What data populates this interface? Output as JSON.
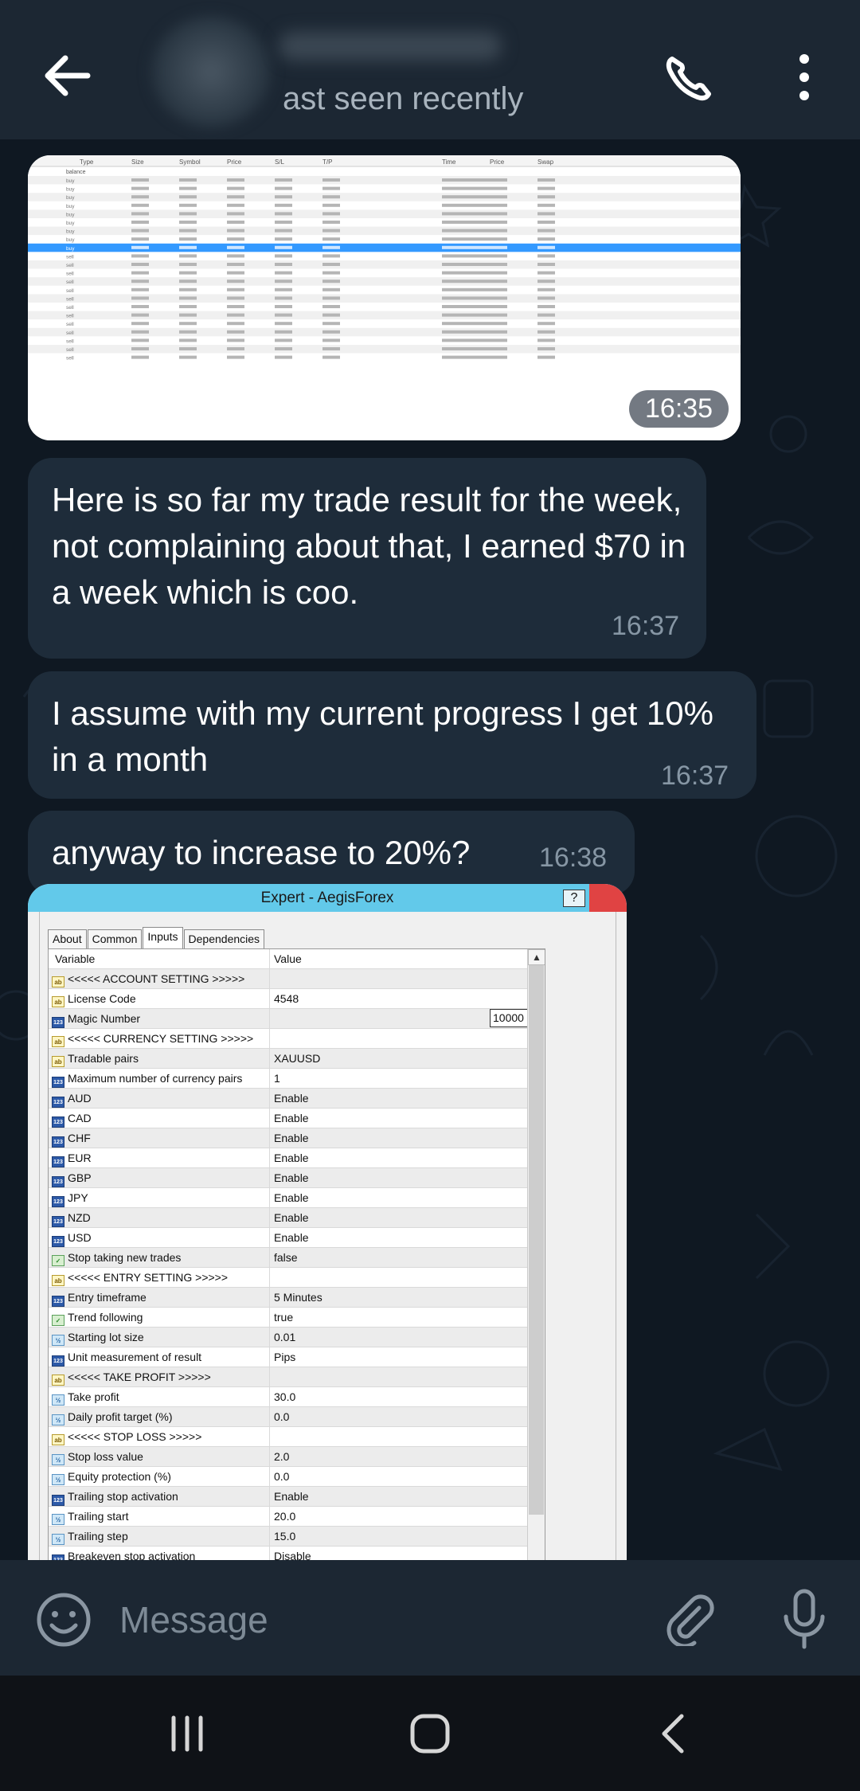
{
  "header": {
    "status": "ast seen recently",
    "icons": [
      "back-arrow-icon",
      "phone-icon",
      "more-vert-icon"
    ]
  },
  "messages": [
    {
      "type": "image",
      "time": "16:35"
    },
    {
      "type": "text",
      "text": "Here is so far my trade result for  the week, not complaining about that, I earned $70 in a week which is coo.",
      "time": "16:37"
    },
    {
      "type": "text",
      "text": "I assume with my current progress I get 10% in a month",
      "time": "16:37"
    },
    {
      "type": "text",
      "text": "anyway to increase to 20%?",
      "time": "16:38"
    }
  ],
  "trade_table": {
    "headers": [
      "Type",
      "Size",
      "Symbol",
      "Price",
      "S/L",
      "T/P",
      "Time",
      "Price",
      "Swap"
    ],
    "first_row": "balance",
    "types": [
      "buy",
      "buy",
      "buy",
      "buy",
      "buy",
      "buy",
      "buy",
      "buy",
      "buy",
      "sell",
      "sell",
      "sell",
      "sell",
      "sell",
      "sell",
      "sell",
      "sell",
      "sell",
      "sell",
      "sell",
      "sell",
      "sell"
    ]
  },
  "expert_dialog": {
    "title": "Expert - AegisForex",
    "help": "?",
    "tabs": [
      "About",
      "Common",
      "Inputs",
      "Dependencies"
    ],
    "active_tab": "Inputs",
    "columns": [
      "Variable",
      "Value"
    ],
    "rows": [
      {
        "icon": "ab",
        "name": "<<<<< ACCOUNT SETTING >>>>>",
        "value": ""
      },
      {
        "icon": "ab",
        "name": "License Code",
        "value": "4548"
      },
      {
        "icon": "123",
        "name": "Magic Number",
        "value": "10000"
      },
      {
        "icon": "ab",
        "name": "<<<<< CURRENCY SETTING >>>>>",
        "value": ""
      },
      {
        "icon": "ab",
        "name": "Tradable pairs",
        "value": "XAUUSD"
      },
      {
        "icon": "123",
        "name": "Maximum number of currency pairs",
        "value": "1"
      },
      {
        "icon": "123",
        "name": "AUD",
        "value": "Enable"
      },
      {
        "icon": "123",
        "name": "CAD",
        "value": "Enable"
      },
      {
        "icon": "123",
        "name": "CHF",
        "value": "Enable"
      },
      {
        "icon": "123",
        "name": "EUR",
        "value": "Enable"
      },
      {
        "icon": "123",
        "name": "GBP",
        "value": "Enable"
      },
      {
        "icon": "123",
        "name": "JPY",
        "value": "Enable"
      },
      {
        "icon": "123",
        "name": "NZD",
        "value": "Enable"
      },
      {
        "icon": "123",
        "name": "USD",
        "value": "Enable"
      },
      {
        "icon": "bool",
        "name": "Stop taking new trades",
        "value": "false"
      },
      {
        "icon": "ab",
        "name": "<<<<< ENTRY SETTING >>>>>",
        "value": ""
      },
      {
        "icon": "123",
        "name": "Entry timeframe",
        "value": "5 Minutes"
      },
      {
        "icon": "bool",
        "name": "Trend following",
        "value": "true"
      },
      {
        "icon": "half",
        "name": "Starting lot size",
        "value": "0.01"
      },
      {
        "icon": "123",
        "name": "Unit measurement of result",
        "value": "Pips"
      },
      {
        "icon": "ab",
        "name": "<<<<< TAKE PROFIT >>>>>",
        "value": ""
      },
      {
        "icon": "half",
        "name": "Take profit",
        "value": "30.0"
      },
      {
        "icon": "half",
        "name": "Daily profit target (%)",
        "value": "0.0"
      },
      {
        "icon": "ab",
        "name": "<<<<< STOP LOSS >>>>>",
        "value": ""
      },
      {
        "icon": "half",
        "name": "Stop loss value",
        "value": "2.0"
      },
      {
        "icon": "half",
        "name": "Equity protection (%)",
        "value": "0.0"
      },
      {
        "icon": "123",
        "name": "Trailing stop activation",
        "value": "Enable"
      },
      {
        "icon": "half",
        "name": "Trailing start",
        "value": "20.0"
      },
      {
        "icon": "half",
        "name": "Trailing step",
        "value": "15.0"
      },
      {
        "icon": "123",
        "name": "Breakeven stop activation",
        "value": "Disable"
      }
    ]
  },
  "input": {
    "placeholder": "Message"
  },
  "colors": {
    "header": "#1c2733",
    "chat_bg": "#0f1822",
    "bubble": "#1e2c3a",
    "timestamp": "#8696a4",
    "dialog_title": "#62c9ea"
  }
}
